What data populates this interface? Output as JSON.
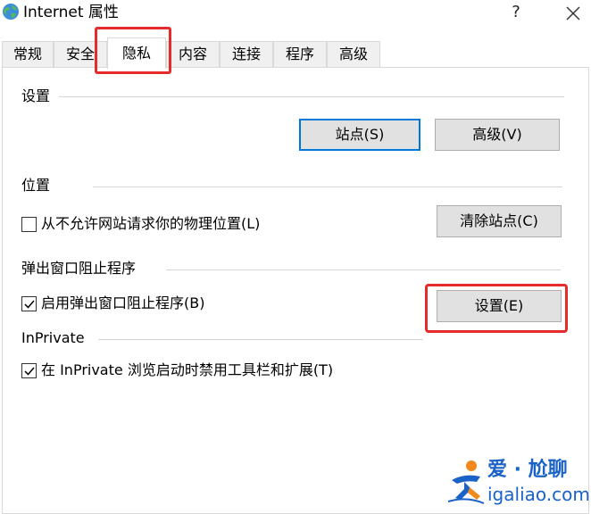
{
  "window": {
    "title": "Internet 属性",
    "help_label": "?",
    "close_icon": "close-icon"
  },
  "tabs": [
    {
      "label": "常规"
    },
    {
      "label": "安全"
    },
    {
      "label": "隐私",
      "active": true
    },
    {
      "label": "内容"
    },
    {
      "label": "连接"
    },
    {
      "label": "程序"
    },
    {
      "label": "高级"
    }
  ],
  "settings_group": {
    "label": "设置",
    "sites_button": "站点(S)",
    "advanced_button": "高级(V)"
  },
  "location_group": {
    "label": "位置",
    "never_allow_label": "从不允许网站请求你的物理位置(L)",
    "never_allow_checked": false,
    "clear_sites_button": "清除站点(C)"
  },
  "popup_group": {
    "label": "弹出窗口阻止程序",
    "enable_label": "启用弹出窗口阻止程序(B)",
    "enable_checked": true,
    "settings_button": "设置(E)"
  },
  "inprivate_group": {
    "label": "InPrivate",
    "disable_toolbars_label": "在 InPrivate 浏览启动时禁用工具栏和扩展(T)",
    "disable_toolbars_checked": true
  },
  "watermark": {
    "title": "爱 · 尬聊",
    "url": "igaliao.com"
  },
  "colors": {
    "highlight": "#e52b2b",
    "accent": "#0078d7",
    "watermark": "#1a62c8"
  }
}
